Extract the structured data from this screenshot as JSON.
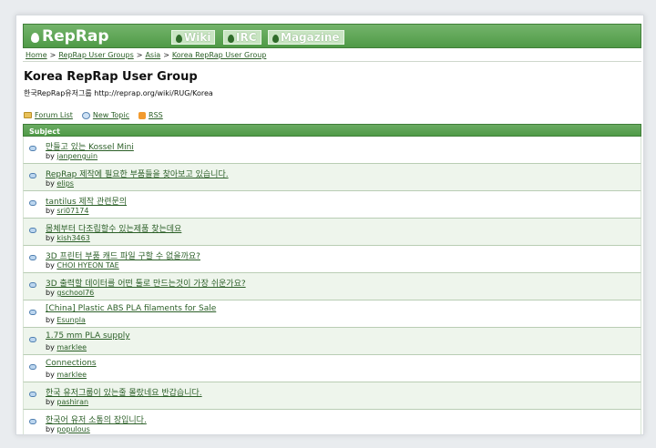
{
  "header": {
    "logo": "RepRap",
    "nav": [
      {
        "label": "Wiki"
      },
      {
        "label": "IRC"
      },
      {
        "label": "Magazine"
      }
    ]
  },
  "breadcrumb": {
    "items": [
      "Home",
      "RepRap User Groups",
      "Asia",
      "Korea RepRap User Group"
    ],
    "separator": ">"
  },
  "page": {
    "title": "Korea RepRap User Group",
    "description": "한국RepRap유저그룹 http://reprap.org/wiki/RUG/Korea"
  },
  "actions": {
    "forum_list": "Forum List",
    "new_topic": "New Topic",
    "rss": "RSS"
  },
  "table": {
    "header": "Subject",
    "by_prefix": "by",
    "rows": [
      {
        "subject": "만들고 있는 Kossel Mini",
        "author": "janpenguin"
      },
      {
        "subject": "RepRap 제작에 필요한 부품들을 찾아보고 있습니다.",
        "author": "elips"
      },
      {
        "subject": "tantilus 제작 관련문의",
        "author": "sri07174"
      },
      {
        "subject": "몸체부터 다조립할수 있는제품 찾는데요",
        "author": "kish3463"
      },
      {
        "subject": "3D 프린터 부품 캐드 파일 구할 수 없을까요?",
        "author": "CHOI HYEON TAE"
      },
      {
        "subject": "3D 출력할 데이터를 어떤 툴로 만드는것이 가장 쉬운가요?",
        "author": "gschool76"
      },
      {
        "subject": "[China] Plastic ABS PLA filaments for Sale",
        "author": "Esunpla"
      },
      {
        "subject": "1.75 mm PLA supply",
        "author": "marklee"
      },
      {
        "subject": "Connections",
        "author": "marklee"
      },
      {
        "subject": "한국 유저그룹이 있는줄 몰랐네요 반갑습니다.",
        "author": "pashiran"
      },
      {
        "subject": "한국어 유저 소통의 장입니다.",
        "author": "populous"
      }
    ]
  },
  "colors": {
    "header_green": "#4f9a47",
    "link_green": "#2b5f27",
    "row_alt": "#eef5ec"
  }
}
